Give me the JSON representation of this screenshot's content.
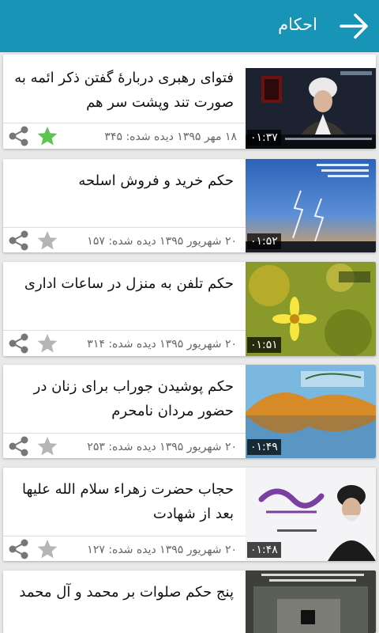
{
  "app_bar": {
    "title": "احکام"
  },
  "accent_color": "#1794b6",
  "items": [
    {
      "title": "فتوای رهبری دربارۀ گفتن ذکر ائمه به صورت تند وپشت سر هم",
      "date": "۱۸ مهر ۱۳۹۵",
      "views_label": "دیده شده:",
      "views": "۳۴۵",
      "duration": "۰۱:۳۷",
      "favorite": true,
      "thumb_icon": "cleric-video-thumbnail"
    },
    {
      "title": "حکم خرید و فروش اسلحه",
      "date": "۲۰ شهریور ۱۳۹۵",
      "views_label": "دیده شده:",
      "views": "۱۵۷",
      "duration": "۰۱:۵۲",
      "favorite": false,
      "thumb_icon": "lightning-sky-thumbnail"
    },
    {
      "title": "حکم تلفن به منزل در ساعات اداری",
      "date": "۲۰ شهریور ۱۳۹۵",
      "views_label": "دیده شده:",
      "views": "۳۱۴",
      "duration": "۰۱:۵۱",
      "favorite": false,
      "thumb_icon": "yellow-flower-thumbnail"
    },
    {
      "title": "حکم پوشیدن جوراب برای زنان در حضور مردان نامحرم",
      "date": "۲۰ شهریور ۱۳۹۵",
      "views_label": "دیده شده:",
      "views": "۲۵۳",
      "duration": "۰۱:۴۹",
      "favorite": false,
      "thumb_icon": "autumn-lake-thumbnail"
    },
    {
      "title": "حجاب حضرت زهراء سلام الله علیها بعد از شهادت",
      "date": "۲۰ شهریور ۱۳۹۵",
      "views_label": "دیده شده:",
      "views": "۱۲۷",
      "duration": "۰۱:۴۸",
      "favorite": false,
      "thumb_icon": "portrait-calligraphy-thumbnail"
    },
    {
      "title": "پنج حکم صلوات بر محمد و آل محمد",
      "date": "",
      "views_label": "",
      "views": "",
      "duration": "",
      "favorite": false,
      "thumb_icon": "kaaba-aerial-thumbnail"
    }
  ]
}
